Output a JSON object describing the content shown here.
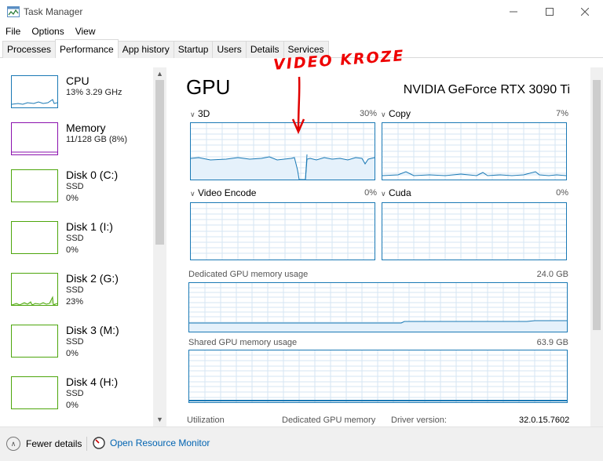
{
  "window": {
    "title": "Task Manager"
  },
  "menu": [
    "File",
    "Options",
    "View"
  ],
  "tabs": [
    "Processes",
    "Performance",
    "App history",
    "Startup",
    "Users",
    "Details",
    "Services"
  ],
  "active_tab": "Performance",
  "sidebar": [
    {
      "title": "CPU",
      "line1": "13% 3.29 GHz",
      "line2": "",
      "color": "#1a79b5"
    },
    {
      "title": "Memory",
      "line1": "11/128 GB (8%)",
      "line2": "",
      "color": "#8b12ae"
    },
    {
      "title": "Disk 0 (C:)",
      "line1": "SSD",
      "line2": "0%",
      "color": "#4da60c"
    },
    {
      "title": "Disk 1 (I:)",
      "line1": "SSD",
      "line2": "0%",
      "color": "#4da60c"
    },
    {
      "title": "Disk 2 (G:)",
      "line1": "SSD",
      "line2": "23%",
      "color": "#4da60c"
    },
    {
      "title": "Disk 3 (M:)",
      "line1": "SSD",
      "line2": "0%",
      "color": "#4da60c"
    },
    {
      "title": "Disk 4 (H:)",
      "line1": "SSD",
      "line2": "0%",
      "color": "#4da60c"
    }
  ],
  "gpu": {
    "title": "GPU",
    "model": "NVIDIA GeForce RTX 3090 Ti",
    "engines": [
      {
        "name": "3D",
        "pct": "30%"
      },
      {
        "name": "Copy",
        "pct": "7%"
      },
      {
        "name": "Video Encode",
        "pct": "0%"
      },
      {
        "name": "Cuda",
        "pct": "0%"
      }
    ],
    "dedicated": {
      "label": "Dedicated GPU memory usage",
      "max": "24.0 GB"
    },
    "shared": {
      "label": "Shared GPU memory usage",
      "max": "63.9 GB"
    },
    "stats": {
      "utilization": "Utilization",
      "dedicated": "Dedicated GPU memory",
      "driver_label": "Driver version:",
      "driver_value": "32.0.15.7602"
    }
  },
  "annotation": "VIDEO KROZE",
  "footer": {
    "fewer": "Fewer details",
    "monitor": "Open Resource Monitor"
  },
  "colors": {
    "gpu_line": "#1a79b5",
    "gpu_fill": "#e5f1fb",
    "grid": "#d6e6f3",
    "link": "#0063b1",
    "annotation": "#e00000"
  }
}
